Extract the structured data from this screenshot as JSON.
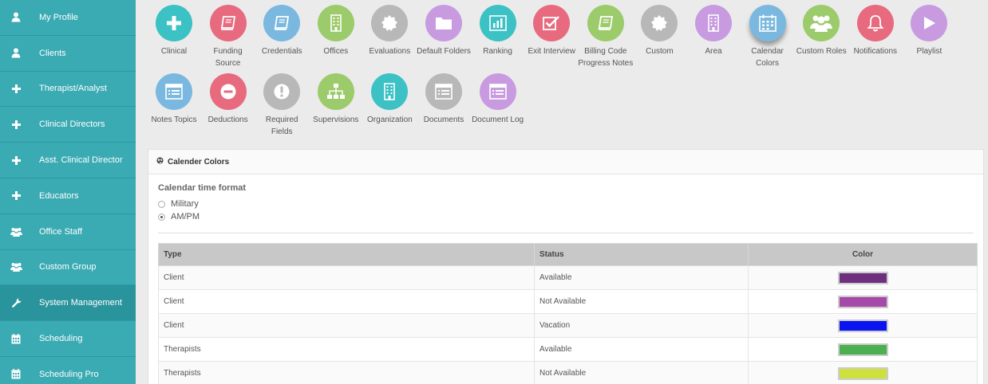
{
  "sidebar": {
    "items": [
      {
        "label": "My Profile",
        "icon": "user-icon"
      },
      {
        "label": "Clients",
        "icon": "user-icon"
      },
      {
        "label": "Therapist/Analyst",
        "icon": "plus-icon"
      },
      {
        "label": "Clinical Directors",
        "icon": "plus-icon"
      },
      {
        "label": "Asst. Clinical Director",
        "icon": "plus-icon"
      },
      {
        "label": "Educators",
        "icon": "plus-icon"
      },
      {
        "label": "Office Staff",
        "icon": "users-icon"
      },
      {
        "label": "Custom Group",
        "icon": "users-icon"
      },
      {
        "label": "System Management",
        "icon": "wrench-icon"
      },
      {
        "label": "Scheduling",
        "icon": "calendar-icon"
      },
      {
        "label": "Scheduling Pro",
        "icon": "calendar-icon"
      }
    ]
  },
  "tiles": [
    {
      "label": "Clinical",
      "color": "#3cc1c4",
      "icon": "plus-icon"
    },
    {
      "label": "Funding Source",
      "color": "#e86a7e",
      "icon": "book-icon"
    },
    {
      "label": "Credentials",
      "color": "#7ab8df",
      "icon": "book-icon"
    },
    {
      "label": "Offices",
      "color": "#9ccb6b",
      "icon": "building-icon"
    },
    {
      "label": "Evaluations",
      "color": "#b8b8b8",
      "icon": "badge-icon"
    },
    {
      "label": "Default Folders",
      "color": "#c89be0",
      "icon": "folder-icon"
    },
    {
      "label": "Ranking",
      "color": "#3cc1c4",
      "icon": "bar-chart-icon"
    },
    {
      "label": "Exit Interview",
      "color": "#e86a7e",
      "icon": "checkbox-icon"
    },
    {
      "label": "Billing Code Progress Notes",
      "color": "#9ccb6b",
      "icon": "book-icon"
    },
    {
      "label": "Custom",
      "color": "#b8b8b8",
      "icon": "badge-icon"
    },
    {
      "label": "Area",
      "color": "#c89be0",
      "icon": "building-icon"
    },
    {
      "label": "Calendar Colors",
      "color": "#7ab8df",
      "icon": "calendar-icon"
    },
    {
      "label": "Custom Roles",
      "color": "#9ccb6b",
      "icon": "users-icon"
    },
    {
      "label": "Notifications",
      "color": "#e86a7e",
      "icon": "bell-icon"
    },
    {
      "label": "Playlist",
      "color": "#c89be0",
      "icon": "play-icon"
    },
    {
      "label": "Notes Topics",
      "color": "#7ab8df",
      "icon": "list-icon"
    },
    {
      "label": "Deductions",
      "color": "#e86a7e",
      "icon": "minus-circle-icon"
    },
    {
      "label": "Required Fields",
      "color": "#b8b8b8",
      "icon": "exclamation-icon"
    },
    {
      "label": "Supervisions",
      "color": "#9ccb6b",
      "icon": "sitemap-icon"
    },
    {
      "label": "Organization",
      "color": "#3cc1c4",
      "icon": "building-icon"
    },
    {
      "label": "Documents",
      "color": "#b8b8b8",
      "icon": "list-icon"
    },
    {
      "label": "Document Log",
      "color": "#c89be0",
      "icon": "list-icon"
    }
  ],
  "panel": {
    "title": "Calender Colors",
    "format_title": "Calendar time format",
    "options": [
      {
        "label": "Military",
        "selected": false
      },
      {
        "label": "AM/PM",
        "selected": true
      }
    ],
    "table": {
      "headers": [
        "Type",
        "Status",
        "Color"
      ],
      "rows": [
        {
          "type": "Client",
          "status": "Available",
          "color": "#6e2f7f"
        },
        {
          "type": "Client",
          "status": "Not Available",
          "color": "#a64aa9"
        },
        {
          "type": "Client",
          "status": "Vacation",
          "color": "#0a14f0"
        },
        {
          "type": "Therapists",
          "status": "Available",
          "color": "#4caf50"
        },
        {
          "type": "Therapists",
          "status": "Not Available",
          "color": "#cde03c"
        }
      ]
    }
  }
}
